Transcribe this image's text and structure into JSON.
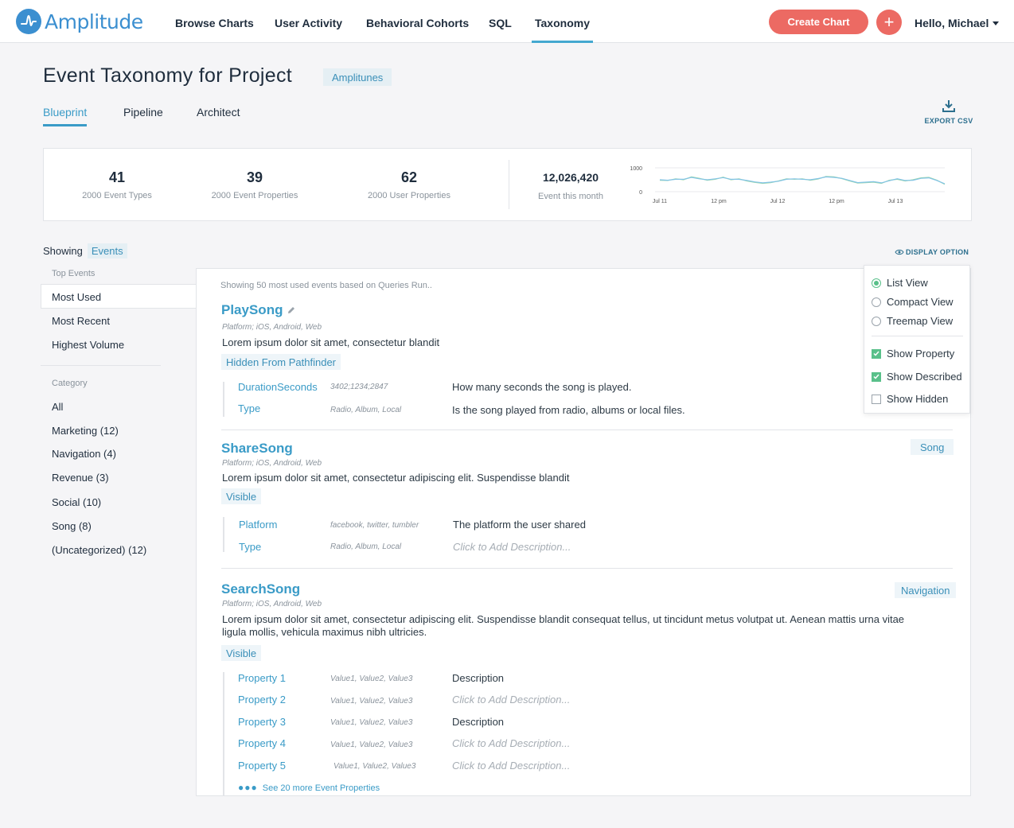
{
  "brand": {
    "name": "Amplitude",
    "color": "#3b8fd0",
    "accent": "#ec6a63"
  },
  "nav": {
    "links": [
      "Browse Charts",
      "User Activity",
      "Behavioral Cohorts",
      "SQL",
      "Taxonomy"
    ],
    "active": "Taxonomy",
    "create_label": "Create Chart",
    "plus_label": "+",
    "user_label": "Hello, Michael"
  },
  "header": {
    "title": "Event Taxonomy for Project",
    "project": "Amplitunes",
    "tabs": [
      "Blueprint",
      "Pipeline",
      "Architect"
    ],
    "active_tab": "Blueprint",
    "export_label": "EXPORT CSV"
  },
  "stats": [
    {
      "value": "41",
      "label": "2000 Event Types"
    },
    {
      "value": "39",
      "label": "2000 Event Properties"
    },
    {
      "value": "62",
      "label": "2000 User Properties"
    },
    {
      "value": "12,026,420",
      "label": "Event this month"
    }
  ],
  "chart_data": {
    "type": "line",
    "yticks": [
      "1000",
      "0"
    ],
    "ylim": [
      0,
      1000
    ],
    "xticks": [
      "Jul 11",
      "12 pm",
      "Jul 12",
      "12 pm",
      "Jul 13"
    ],
    "series": [
      {
        "color": "#9ad7a8",
        "values": [
          480,
          470,
          540,
          500,
          620,
          560,
          480,
          520,
          610,
          500,
          540,
          450,
          390,
          350,
          380,
          450,
          540,
          520,
          540,
          480,
          530,
          640,
          620,
          550,
          450,
          360,
          380,
          400,
          350,
          480,
          520,
          450,
          500,
          580,
          600,
          480,
          310
        ]
      },
      {
        "color": "#82c3e6",
        "values": [
          500,
          480,
          520,
          520,
          600,
          540,
          500,
          540,
          590,
          520,
          520,
          470,
          410,
          370,
          400,
          440,
          520,
          540,
          520,
          500,
          550,
          620,
          600,
          560,
          470,
          380,
          400,
          420,
          370,
          460,
          540,
          470,
          480,
          560,
          580,
          470,
          330
        ]
      }
    ]
  },
  "sidebar": {
    "showing_label": "Showing",
    "showing_value": "Events",
    "top_head": "Top Events",
    "top_items": [
      "Most Used",
      "Most Recent",
      "Highest Volume"
    ],
    "category_head": "Category",
    "categories": [
      "All",
      "Marketing (12)",
      "Navigation (4)",
      "Revenue (3)",
      "Social (10)",
      "Song (8)",
      "(Uncategorized) (12)"
    ]
  },
  "panel": {
    "note": "Showing 50 most used events based on Queries Run..",
    "events": [
      {
        "name": "PlaySong",
        "platform": "Platform; iOS, Android, Web",
        "description": "Lorem ipsum dolor sit amet, consectetur blandit",
        "status": "Hidden From Pathfinder",
        "category": "",
        "properties": [
          {
            "name": "DurationSeconds",
            "values": "3402;1234;2847",
            "description": "How many seconds the song is played."
          },
          {
            "name": "Type",
            "values": "Radio, Album, Local",
            "description": "Is the song played from radio, albums or local files."
          }
        ]
      },
      {
        "name": "ShareSong",
        "platform": "Platform; iOS, Android, Web",
        "description": "Lorem ipsum dolor sit amet, consectetur adipiscing elit. Suspendisse blandit",
        "status": "Visible",
        "category": "Song",
        "properties": [
          {
            "name": "Platform",
            "values": "facebook, twitter, tumbler",
            "description": "The platform the user shared"
          },
          {
            "name": "Type",
            "values": "Radio, Album, Local",
            "description": "Click to Add Description..."
          }
        ]
      },
      {
        "name": "SearchSong",
        "platform": "Platform; iOS, Android, Web",
        "description": "Lorem ipsum dolor sit amet, consectetur adipiscing elit. Suspendisse blandit consequat tellus, ut tincidunt metus volutpat ut. Aenean mattis urna vitae ligula mollis, vehicula maximus nibh ultricies.",
        "status": "Visible",
        "category": "Navigation",
        "properties": [
          {
            "name": "Property 1",
            "values": "Value1, Value2, Value3",
            "description": "Description"
          },
          {
            "name": "Property 2",
            "values": "Value1, Value2, Value3",
            "description": "Click to Add Description..."
          },
          {
            "name": "Property 3",
            "values": "Value1, Value2, Value3",
            "description": "Description"
          },
          {
            "name": "Property 4",
            "values": "Value1, Value2, Value3",
            "description": "Click to Add Description..."
          },
          {
            "name": "Property 5",
            "values": "Value1, Value2, Value3",
            "description": "Click to Add Description..."
          }
        ],
        "see_more": "See 20 more Event Properties"
      }
    ]
  },
  "display_option": {
    "label": "DISPLAY OPTION",
    "views": [
      "List View",
      "Compact View",
      "Treemap View"
    ],
    "selected_view": "List View",
    "toggles": [
      {
        "label": "Show Property",
        "checked": true
      },
      {
        "label": "Show Described",
        "checked": true
      },
      {
        "label": "Show Hidden",
        "checked": false
      }
    ]
  }
}
